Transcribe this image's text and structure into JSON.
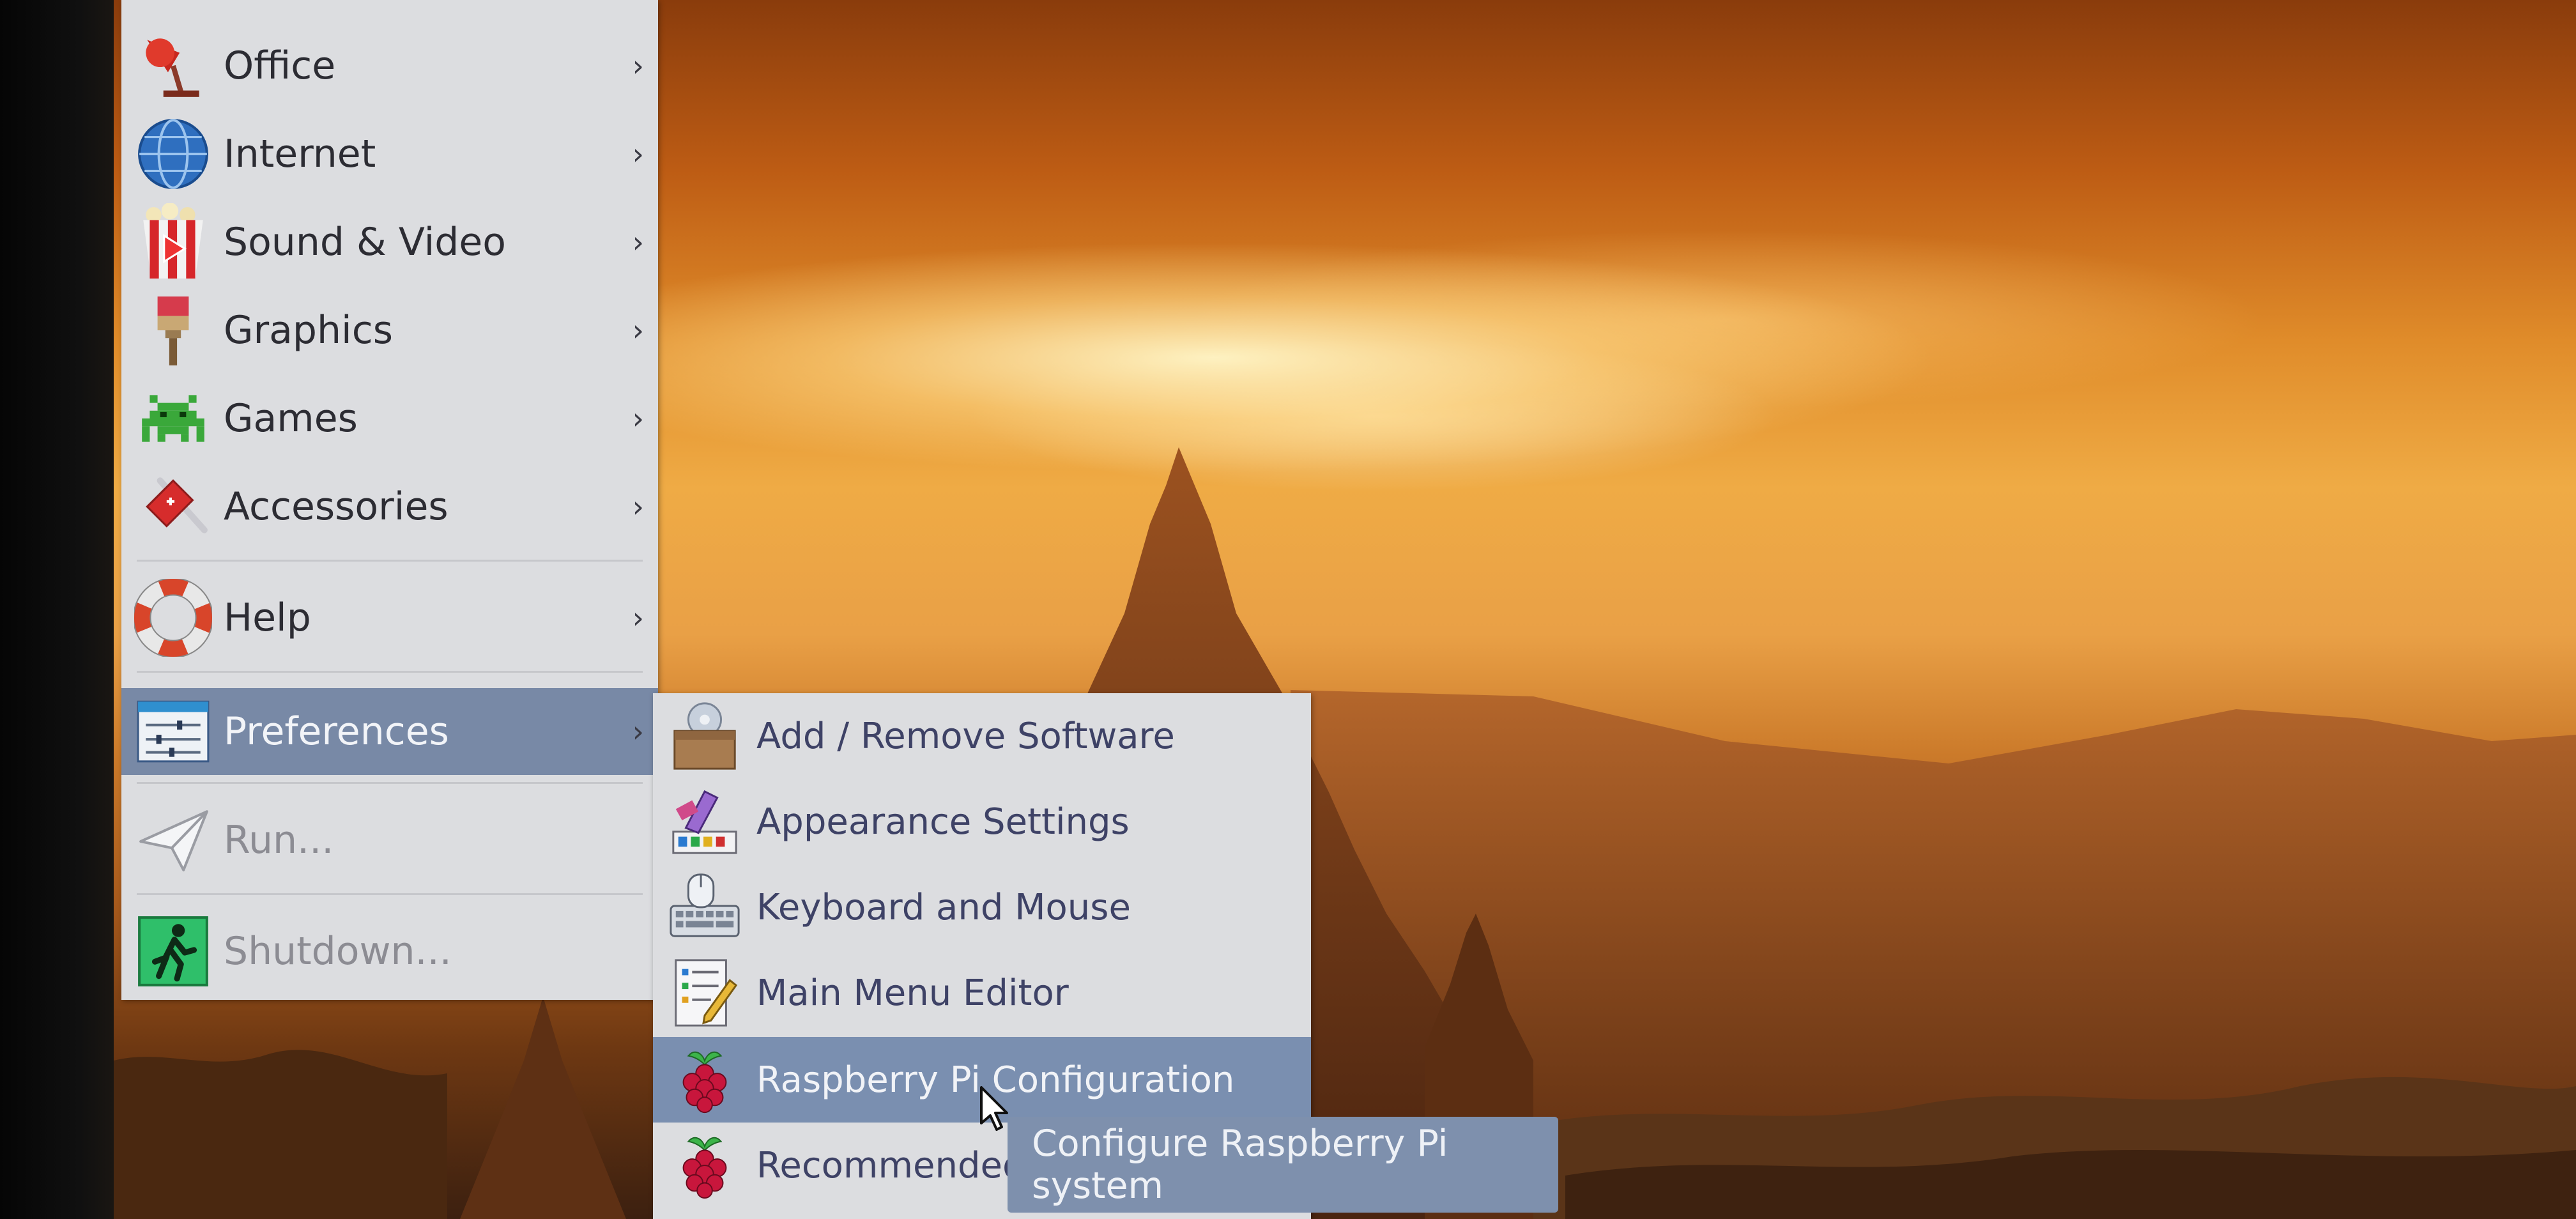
{
  "main_menu": {
    "items": [
      {
        "label": "Office",
        "icon": "office-lamp-icon"
      },
      {
        "label": "Internet",
        "icon": "globe-icon"
      },
      {
        "label": "Sound & Video",
        "icon": "popcorn-icon"
      },
      {
        "label": "Graphics",
        "icon": "paintbrush-icon"
      },
      {
        "label": "Games",
        "icon": "space-invader-icon"
      },
      {
        "label": "Accessories",
        "icon": "swiss-knife-icon"
      },
      {
        "label": "Help",
        "icon": "lifebuoy-icon"
      },
      {
        "label": "Preferences",
        "icon": "preferences-sliders-icon",
        "active": true
      },
      {
        "label": "Run...",
        "icon": "paper-plane-icon"
      },
      {
        "label": "Shutdown...",
        "icon": "exit-person-icon"
      }
    ],
    "submenu_arrow": "›"
  },
  "preferences_submenu": {
    "items": [
      {
        "label": "Add / Remove Software",
        "icon": "package-icon"
      },
      {
        "label": "Appearance Settings",
        "icon": "palette-icon"
      },
      {
        "label": "Keyboard and Mouse",
        "icon": "keyboard-mouse-icon"
      },
      {
        "label": "Main Menu Editor",
        "icon": "menu-editor-icon"
      },
      {
        "label": "Raspberry Pi Configuration",
        "icon": "raspberry-icon",
        "active": true
      },
      {
        "label": "Recommended",
        "icon": "raspberry-icon"
      }
    ]
  },
  "tooltip": {
    "text": "Configure Raspberry Pi system"
  },
  "colors": {
    "menu_bg": "#dcdde0",
    "highlight": "#7889a6",
    "tooltip_bg": "#7e90ad",
    "text": "#2c2c33"
  }
}
